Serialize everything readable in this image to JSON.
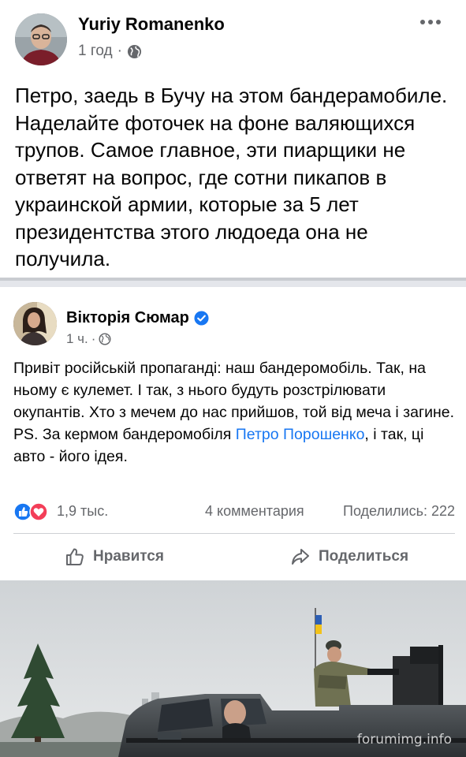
{
  "post": {
    "author": "Yuriy Romanenko",
    "time": "1 год",
    "separator": "·",
    "text": "Петро, заедь в Бучу на этом бандерамобиле. Наделайте фоточек на фоне валяющихся трупов. Самое главное, эти пиарщики не ответят на вопрос, где сотни пикапов в украинской армии, которые за 5 лет президентства этого людоеда она не получила."
  },
  "shared_post": {
    "author": "Вікторія Сюмар",
    "time": "1 ч.",
    "separator": "·",
    "text_main": "Привіт російській пропаганді: наш бандеромобіль. Так, на ньому є кулемет. І так, з нього будуть розстрілювати окупантів. Хто з мечем до нас прийшов, той від меча і загине.",
    "text_ps_before": "PS. За кермом бандеромобіля ",
    "text_ps_link": "Петро Порошенко",
    "text_ps_after": ", і так, ці авто - його ідея.",
    "reactions_count": "1,9 тыс.",
    "comments": "4 комментария",
    "shares": "Поделились: 222",
    "like_label": "Нравится",
    "share_label": "Поделиться"
  },
  "photo": {
    "watermark": "forumimg.info"
  },
  "colors": {
    "link": "#1877f2",
    "secondary_text": "#65676b",
    "verified": "#1877f2",
    "like_reaction": "#1877f2",
    "love_reaction": "#f33e58"
  },
  "icons": [
    "more-dots-icon",
    "globe-icon",
    "verified-badge-icon",
    "like-reaction-icon",
    "love-reaction-icon",
    "thumbs-up-icon",
    "share-arrow-icon"
  ]
}
